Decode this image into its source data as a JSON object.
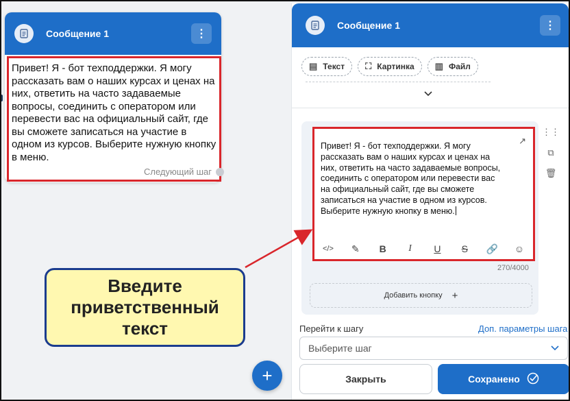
{
  "left_card": {
    "title": "Сообщение 1",
    "message": "Привет! Я - бот техподдержки. Я могу рассказать вам о наших курсах и ценах на них, ответить на часто задаваемые вопросы, соединить с оператором или перевести вас на официальный сайт, где вы сможете записаться на участие в одном из курсов. Выберите нужную кнопку в меню.",
    "next_step": "Следующий шаг"
  },
  "panel": {
    "title": "Сообщение 1",
    "chips": [
      "Текст",
      "Картинка",
      "Файл"
    ],
    "editor_text": "Привет! Я - бот техподдержки. Я могу рассказать вам о наших курсах и ценах на них, ответить на часто задаваемые вопросы, соединить с оператором или перевести вас на официальный сайт, где вы сможете записаться на участие в одном из курсов. Выберите нужную кнопку в меню.",
    "counter": "270/4000",
    "add_button": "Добавить кнопку",
    "goto_label": "Перейти к шагу",
    "more_params": "Доп. параметры шага",
    "select_placeholder": "Выберите шаг",
    "close_label": "Закрыть",
    "save_label": "Сохранено"
  },
  "callout": {
    "text": "Введите приветственный текст"
  },
  "colors": {
    "brand": "#1e6ec8",
    "highlight_border": "#d9262b",
    "callout_bg": "#fff8b0",
    "callout_border": "#1b3c8e"
  },
  "icons": {
    "doc": "document-icon",
    "menu": "kebab-menu-icon",
    "add": "plus-icon",
    "toolbar": [
      "code-icon",
      "eraser-icon",
      "bold-icon",
      "italic-icon",
      "underline-icon",
      "strikethrough-icon",
      "link-icon",
      "emoji-icon"
    ]
  }
}
